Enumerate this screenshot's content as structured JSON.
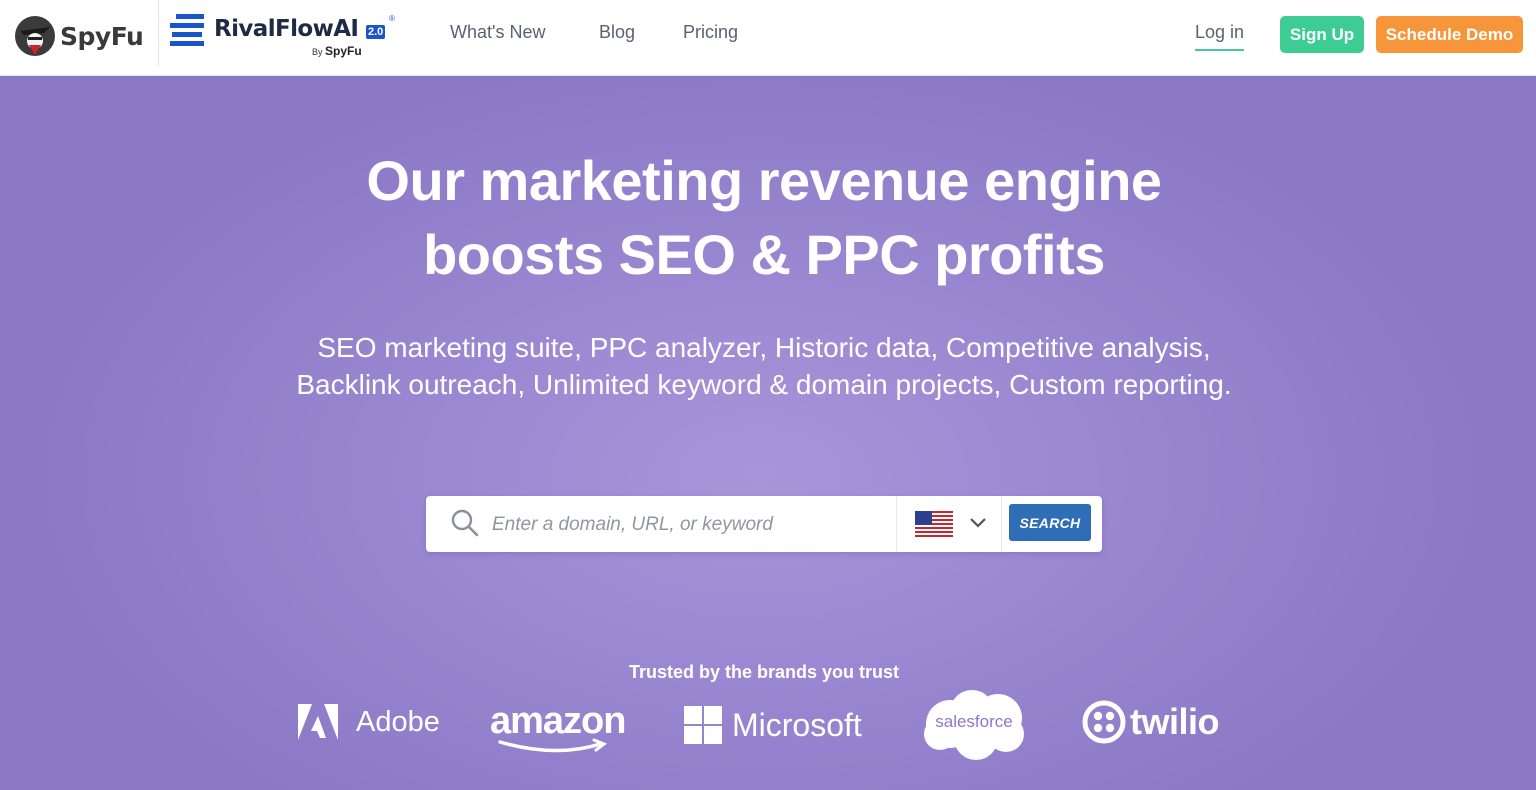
{
  "header": {
    "spyfu_logo_text": "SpyFu",
    "rival_logo_text": "RivalFlowAI",
    "rival_version": "2.0",
    "rival_by_prefix": "By",
    "rival_by_brand": "SpyFu",
    "nav": [
      "What's New",
      "Blog",
      "Pricing"
    ],
    "login_label": "Log in",
    "signup_label": "Sign Up",
    "demo_label": "Schedule Demo"
  },
  "hero": {
    "headline_line1": "Our marketing revenue engine",
    "headline_line2": "boosts SEO & PPC profits",
    "subhead": "SEO marketing suite, PPC analyzer, Historic data, Competitive analysis, Backlink outreach, Unlimited keyword & domain projects, Custom reporting."
  },
  "search": {
    "placeholder": "Enter a domain, URL, or keyword",
    "button_label": "SEARCH",
    "country_selected": "United States"
  },
  "trusted": {
    "heading": "Trusted by the brands you trust",
    "brands": [
      "Adobe",
      "amazon",
      "Microsoft",
      "salesforce",
      "twilio"
    ]
  },
  "colors": {
    "hero_bg": "#8c78c8",
    "signup": "#3dcc93",
    "demo": "#f7953a",
    "search_button": "#2f6db7",
    "login_underline": "#49c6a1"
  },
  "icons": {
    "spyfu": "spyfu-spy-icon",
    "rival": "rivalflow-stripes-icon",
    "search": "search-icon",
    "flag": "us-flag-icon",
    "chevron": "chevron-down-icon"
  }
}
